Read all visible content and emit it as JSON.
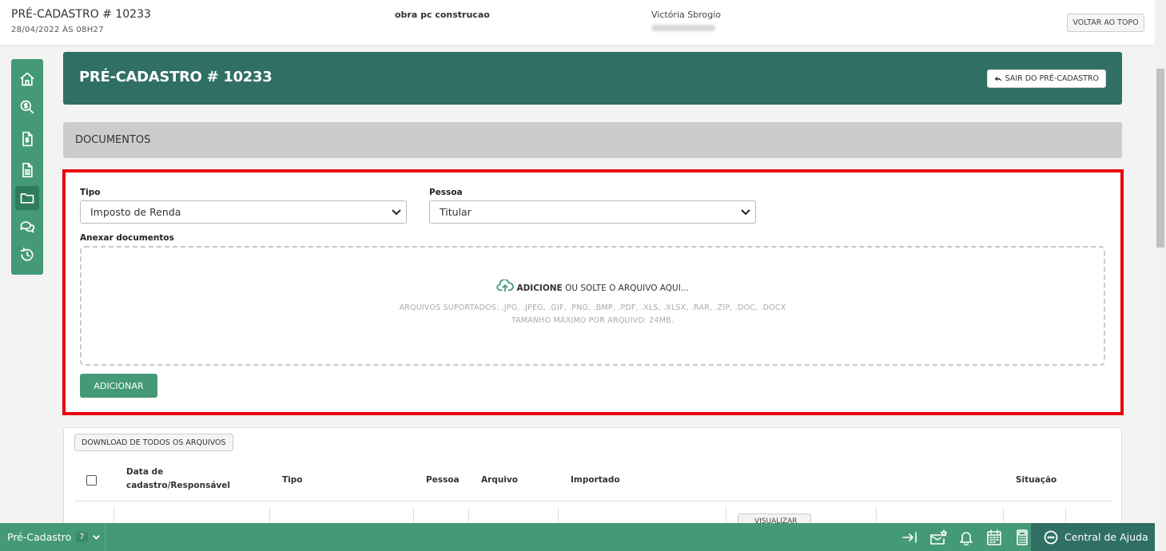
{
  "header": {
    "title": "PRÉ-CADASTRO # 10233",
    "date": "28/04/2022 ÀS 08H27",
    "obra": "obra pc construcao",
    "user": "Victória Sbrogio",
    "back_to_top": "VOLTAR AO TOPO"
  },
  "sidebar": {
    "items": [
      {
        "name": "home-icon"
      },
      {
        "name": "search-dollar-icon"
      },
      {
        "name": "invoice-icon"
      },
      {
        "name": "document-icon"
      },
      {
        "name": "folder-icon",
        "active": true
      },
      {
        "name": "chat-icon"
      },
      {
        "name": "history-icon"
      }
    ]
  },
  "page": {
    "title": "PRÉ-CADASTRO # 10233",
    "exit_button": "SAIR DO PRÉ-CADASTRO",
    "section": "DOCUMENTOS"
  },
  "form": {
    "tipo_label": "Tipo",
    "tipo_value": "Imposto de Renda",
    "pessoa_label": "Pessoa",
    "pessoa_value": "Titular",
    "attach_label": "Anexar documentos",
    "dz_strong": "ADICIONE",
    "dz_rest": "OU SOLTE O ARQUIVO AQUI...",
    "dz_formats": "ARQUIVOS SUPORTADOS: .JPG, .JPEG, .GIF, .PNG, .BMP, .PDF, .XLS, .XLSX, .RAR, .ZIP, .DOC, .DOCX",
    "dz_size": "TAMANHO MÁXIMO POR ARQUIVO: 24MB.",
    "add_button": "ADICIONAR"
  },
  "table": {
    "download_all": "DOWNLOAD DE TODOS OS ARQUIVOS",
    "columns": {
      "date_line1": "Data de",
      "date_line2": "cadastro/Responsável",
      "tipo": "Tipo",
      "pessoa": "Pessoa",
      "arquivo": "Arquivo",
      "importado": "Importado",
      "situacao": "Situação"
    },
    "view_button": "VISUALIZAR"
  },
  "bottombar": {
    "module": "Pré-Cadastro",
    "module_badge": "7",
    "help": "Central de Ajuda"
  },
  "colors": {
    "primary": "#449a76",
    "dark": "#2f6f64",
    "highlight": "#e8000d"
  }
}
